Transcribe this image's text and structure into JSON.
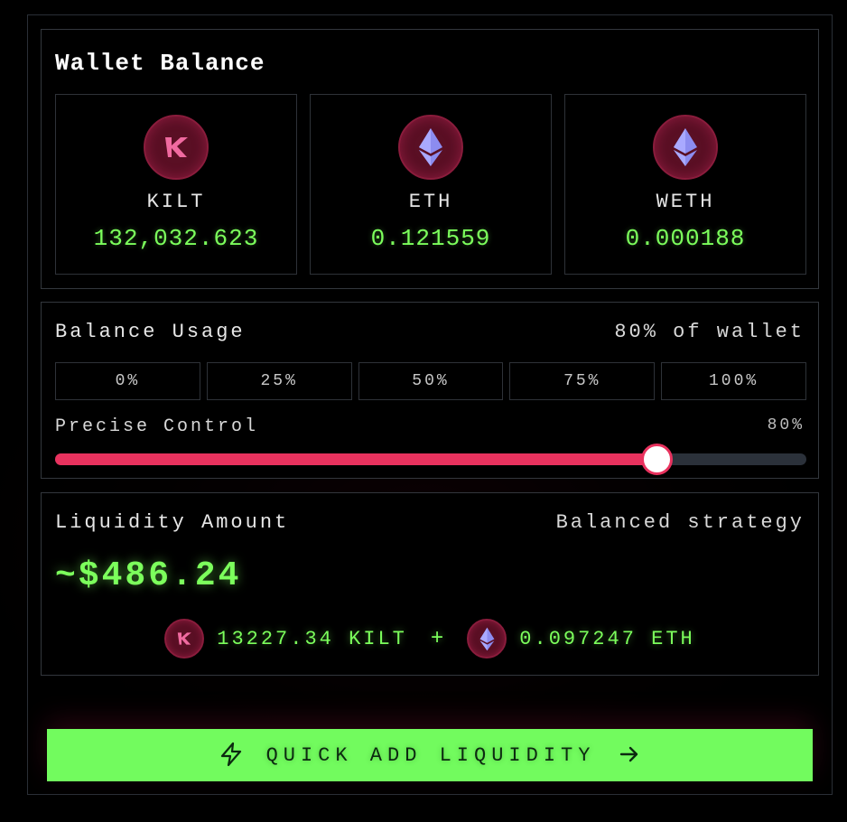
{
  "wallet": {
    "title": "Wallet Balance",
    "tokens": [
      {
        "symbol": "KILT",
        "balance": "132,032.623",
        "icon": "kilt-logo-icon"
      },
      {
        "symbol": "ETH",
        "balance": "0.121559",
        "icon": "ethereum-icon"
      },
      {
        "symbol": "WETH",
        "balance": "0.000188",
        "icon": "ethereum-icon"
      }
    ]
  },
  "usage": {
    "title": "Balance Usage",
    "summary": "80% of wallet",
    "presets": [
      "0%",
      "25%",
      "50%",
      "75%",
      "100%"
    ],
    "precise_label": "Precise Control",
    "precise_value": "80%",
    "slider_percent": 80
  },
  "liquidity": {
    "title": "Liquidity Amount",
    "strategy": "Balanced strategy",
    "amount": "~$486.24",
    "kilt_amount": "13227.34 KILT",
    "plus": "+",
    "eth_amount": "0.097247 ETH"
  },
  "action": {
    "label": "QUICK ADD LIQUIDITY",
    "icon_left": "lightning-icon",
    "icon_right": "arrow-right-icon"
  },
  "colors": {
    "accent_green": "#72fb5e",
    "accent_pink": "#e8325e",
    "icon_bg": "#5a0f24",
    "eth_blue": "#8c8cf0",
    "kilt_pink": "#f06aa0"
  }
}
